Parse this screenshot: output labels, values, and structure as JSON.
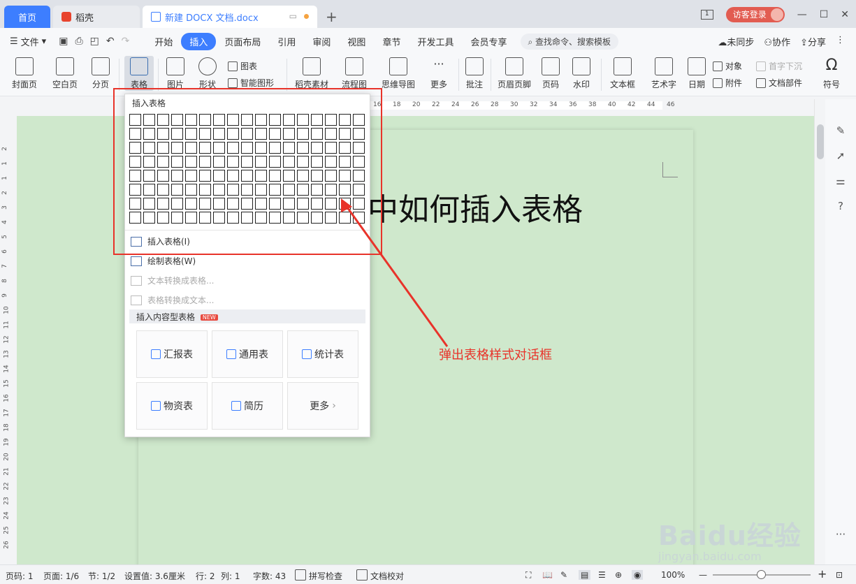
{
  "tabs": {
    "home": "首页",
    "daoke": "稻壳",
    "doc": "新建 DOCX 文档.docx",
    "new_tab": "+"
  },
  "window": {
    "page_indicator": "1",
    "login": "访客登录",
    "minimize": "—",
    "maximize": "☐",
    "close": "✕"
  },
  "menu": {
    "file": "文件",
    "tabs": [
      "开始",
      "插入",
      "页面布局",
      "引用",
      "审阅",
      "视图",
      "章节",
      "开发工具",
      "会员专享"
    ],
    "active_tab": "插入",
    "search_placeholder": "查找命令、搜索模板",
    "sync": "未同步",
    "collab": "协作",
    "share": "分享"
  },
  "ribbon": {
    "cover": "封面页",
    "blank": "空白页",
    "section_break": "分页",
    "table": "表格",
    "picture": "图片",
    "shape": "形状",
    "chart": "图表",
    "smart_shape": "智能图形",
    "daoke_material": "稻壳素材",
    "flowchart": "流程图",
    "mindmap": "思维导图",
    "more": "更多",
    "comment": "批注",
    "header_footer": "页眉页脚",
    "page_number": "页码",
    "watermark": "水印",
    "textbox": "文本框",
    "wordart": "艺术字",
    "date": "日期",
    "object": "对象",
    "attachment": "附件",
    "dropcap": "首字下沉",
    "doc_parts": "文档部件",
    "symbol": "符号"
  },
  "ruler": {
    "top_numbers": [
      "16",
      "18",
      "20",
      "22",
      "24",
      "26",
      "28",
      "30",
      "32",
      "34",
      "36",
      "38",
      "40",
      "42",
      "44",
      "46"
    ],
    "left_numbers": [
      "2",
      "1",
      "1",
      "2",
      "3",
      "4",
      "5",
      "6",
      "7",
      "8",
      "9",
      "10",
      "11",
      "12",
      "13",
      "14",
      "15",
      "16",
      "17",
      "18",
      "19",
      "20",
      "21",
      "22",
      "23",
      "24",
      "25",
      "26"
    ]
  },
  "document": {
    "heading_partial": "中如何插入表格"
  },
  "dropdown": {
    "title": "插入表格",
    "grid_rows": 8,
    "grid_cols": 17,
    "insert_table": "插入表格(I)",
    "draw_table": "绘制表格(W)",
    "text_to_table": "文本转换成表格...",
    "table_to_text": "表格转换成文本...",
    "content_section": "插入内容型表格",
    "new_badge": "NEW",
    "cards": [
      "汇报表",
      "通用表",
      "统计表",
      "物资表",
      "简历",
      "更多"
    ]
  },
  "annotation": {
    "text": "弹出表格样式对话框",
    "color": "#e8332a"
  },
  "status": {
    "page_code": "页码: 1",
    "page": "页面: 1/6",
    "section": "节: 1/2",
    "setting": "设置值: 3.6厘米",
    "line": "行: 2",
    "col": "列: 1",
    "wordcount": "字数: 43",
    "spellcheck": "拼写检查",
    "proofread": "文档校对",
    "zoom": "100%",
    "zoom_out": "—",
    "zoom_in": "+"
  },
  "watermark": {
    "brand": "Baidu经验",
    "url": "jingyan.baidu.com"
  },
  "colors": {
    "accent": "#3d7eff",
    "doc_bg": "#cfe8cc",
    "login": "#e25c51"
  }
}
